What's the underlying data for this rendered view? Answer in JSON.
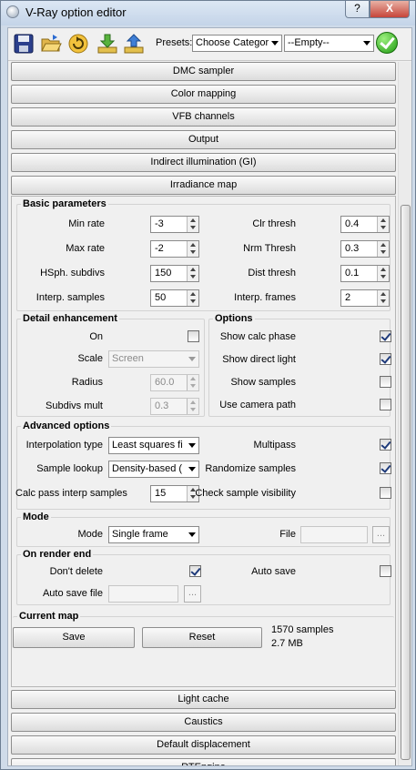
{
  "window": {
    "title": "V-Ray option editor",
    "help_label": "?",
    "close_label": "X"
  },
  "toolbar": {
    "presets_label": "Presets:",
    "preset_category": "Choose Categor",
    "preset_item": "--Empty--",
    "tools": [
      "save-icon",
      "open-folder-icon",
      "refresh-icon",
      "import-icon",
      "export-icon",
      "ok-check-icon"
    ]
  },
  "rollouts_top": [
    "DMC sampler",
    "Color mapping",
    "VFB channels",
    "Output",
    "Indirect illumination (GI)",
    "Irradiance map"
  ],
  "basic": {
    "title": "Basic parameters",
    "min_rate_label": "Min rate",
    "min_rate": "-3",
    "max_rate_label": "Max rate",
    "max_rate": "-2",
    "hsph_label": "HSph. subdivs",
    "hsph": "150",
    "interp_samples_label": "Interp. samples",
    "interp_samples": "50",
    "clr_thresh_label": "Clr thresh",
    "clr_thresh": "0.4",
    "nrm_thresh_label": "Nrm Thresh",
    "nrm_thresh": "0.3",
    "dist_thresh_label": "Dist thresh",
    "dist_thresh": "0.1",
    "interp_frames_label": "Interp. frames",
    "interp_frames": "2"
  },
  "detail": {
    "title": "Detail enhancement",
    "on_label": "On",
    "on": false,
    "scale_label": "Scale",
    "scale": "Screen",
    "radius_label": "Radius",
    "radius": "60.0",
    "subdivs_mult_label": "Subdivs mult",
    "subdivs_mult": "0.3"
  },
  "options": {
    "title": "Options",
    "show_calc_phase_label": "Show calc phase",
    "show_calc_phase": true,
    "show_direct_light_label": "Show direct light",
    "show_direct_light": true,
    "show_samples_label": "Show samples",
    "show_samples": false,
    "use_camera_path_label": "Use camera path",
    "use_camera_path": false
  },
  "advanced": {
    "title": "Advanced options",
    "interp_type_label": "Interpolation type",
    "interp_type": "Least squares fi",
    "sample_lookup_label": "Sample lookup",
    "sample_lookup": "Density-based (",
    "calc_pass_label": "Calc pass interp samples",
    "calc_pass": "15",
    "multipass_label": "Multipass",
    "multipass": true,
    "randomize_label": "Randomize samples",
    "randomize": true,
    "check_vis_label": "Check sample visibility",
    "check_vis": false
  },
  "mode": {
    "title": "Mode",
    "mode_label": "Mode",
    "mode": "Single frame",
    "file_label": "File",
    "browse_label": "..."
  },
  "render_end": {
    "title": "On render end",
    "dont_delete_label": "Don't delete",
    "dont_delete": true,
    "auto_save_label": "Auto save",
    "auto_save": false,
    "auto_save_file_label": "Auto save file",
    "browse_label": "..."
  },
  "current_map": {
    "title": "Current map",
    "save_label": "Save",
    "reset_label": "Reset",
    "samples": "1570 samples",
    "size": "2.7 MB"
  },
  "rollouts_bottom": [
    "Light cache",
    "Caustics",
    "Default displacement",
    "RTEngine"
  ],
  "colors": {
    "title_bar": "#c4d4e8",
    "close_button": "#c6453a",
    "client_bg": "#f0f0f0"
  }
}
